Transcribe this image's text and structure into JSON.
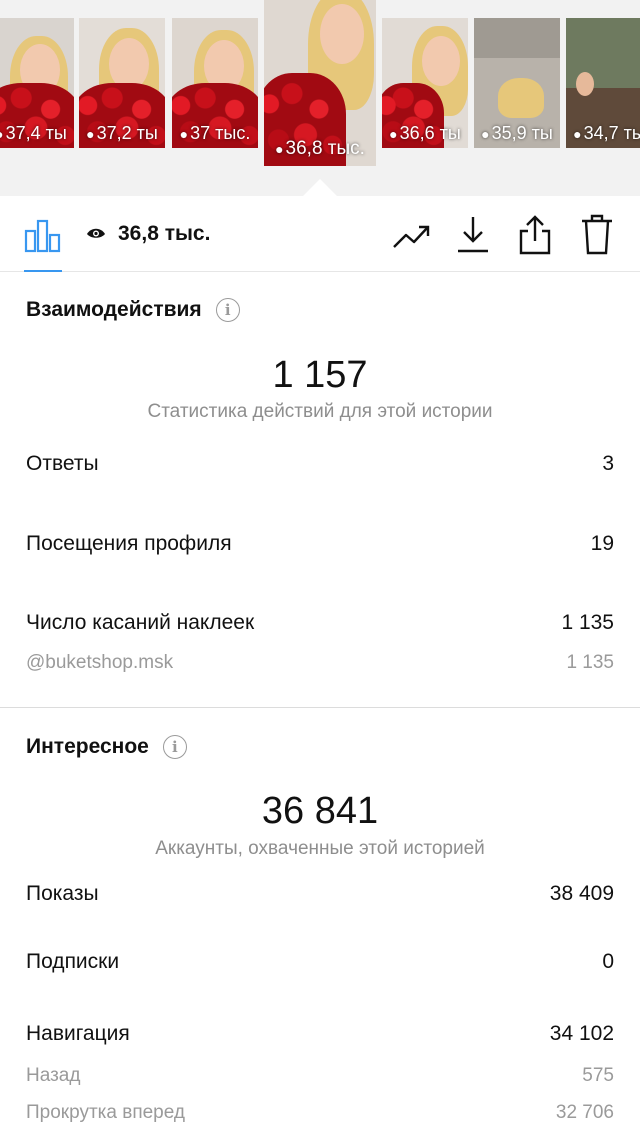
{
  "stories": [
    {
      "views": "37,4 ты",
      "bg": "#d9d4cf",
      "active": false
    },
    {
      "views": "37,2 ты",
      "bg": "#e3ddd7",
      "active": false
    },
    {
      "views": "37 тыс.",
      "bg": "#ddd6cf",
      "active": false
    },
    {
      "views": "36,8 тыс.",
      "bg": "#dfd8d1",
      "active": true
    },
    {
      "views": "36,6 ты",
      "bg": "#e1dbd5",
      "active": false
    },
    {
      "views": "35,9 ты",
      "bg": "#9f9a92",
      "active": false
    },
    {
      "views": "34,7 ты",
      "bg": "#6e7a5f",
      "active": false
    }
  ],
  "toolbar": {
    "views_count": "36,8 тыс.",
    "icons": [
      "bar-chart-icon",
      "eye-icon",
      "trend-icon",
      "download-icon",
      "share-icon",
      "trash-icon"
    ],
    "accent_color": "#3897f0"
  },
  "interactions": {
    "title": "Взаимодействия",
    "total": "1 157",
    "caption": "Статистика действий для этой истории",
    "rows": [
      {
        "label": "Ответы",
        "value": "3"
      },
      {
        "label": "Посещения профиля",
        "value": "19"
      },
      {
        "label": "Число касаний наклеек",
        "value": "1 135"
      }
    ],
    "sub_rows": [
      {
        "label": "@buketshop.msk",
        "value": "1 135"
      }
    ]
  },
  "discovery": {
    "title": "Интересное",
    "total": "36 841",
    "caption": "Аккаунты, охваченные этой историей",
    "rows": [
      {
        "label": "Показы",
        "value": "38 409"
      },
      {
        "label": "Подписки",
        "value": "0"
      },
      {
        "label": "Навигация",
        "value": "34 102"
      }
    ],
    "sub_rows": [
      {
        "label": "Назад",
        "value": "575"
      },
      {
        "label": "Прокрутка вперед",
        "value": "32 706"
      }
    ]
  }
}
